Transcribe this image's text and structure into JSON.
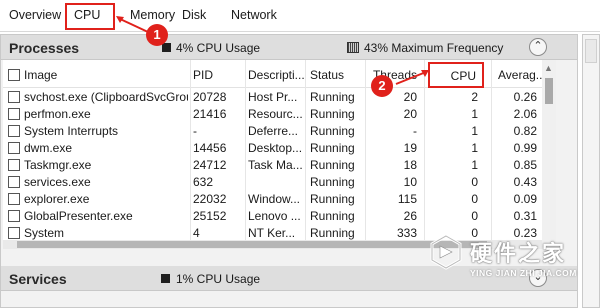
{
  "tabs": [
    "Overview",
    "CPU",
    "Memory",
    "Disk",
    "Network"
  ],
  "processes": {
    "title": "Processes",
    "cpu_usage": "4% CPU Usage",
    "max_frequency": "43% Maximum Frequency",
    "collapse_glyph": "⌃",
    "columns": [
      "Image",
      "PID",
      "Descripti...",
      "Status",
      "Threads",
      "CPU",
      "Averag..."
    ],
    "rows": [
      {
        "image": "svchost.exe (ClipboardSvcGrou...",
        "pid": "20728",
        "description": "Host Pr...",
        "status": "Running",
        "threads": "20",
        "cpu": "2",
        "avg": "0.26"
      },
      {
        "image": "perfmon.exe",
        "pid": "21416",
        "description": "Resourc...",
        "status": "Running",
        "threads": "20",
        "cpu": "1",
        "avg": "2.06"
      },
      {
        "image": "System Interrupts",
        "pid": "-",
        "description": "Deferre...",
        "status": "Running",
        "threads": "-",
        "cpu": "1",
        "avg": "0.82"
      },
      {
        "image": "dwm.exe",
        "pid": "14456",
        "description": "Desktop...",
        "status": "Running",
        "threads": "19",
        "cpu": "1",
        "avg": "0.99"
      },
      {
        "image": "Taskmgr.exe",
        "pid": "24712",
        "description": "Task Ma...",
        "status": "Running",
        "threads": "18",
        "cpu": "1",
        "avg": "0.85"
      },
      {
        "image": "services.exe",
        "pid": "632",
        "description": "",
        "status": "Running",
        "threads": "10",
        "cpu": "0",
        "avg": "0.43"
      },
      {
        "image": "explorer.exe",
        "pid": "22032",
        "description": "Window...",
        "status": "Running",
        "threads": "115",
        "cpu": "0",
        "avg": "0.09"
      },
      {
        "image": "GlobalPresenter.exe",
        "pid": "25152",
        "description": "Lenovo ...",
        "status": "Running",
        "threads": "26",
        "cpu": "0",
        "avg": "0.31"
      },
      {
        "image": "System",
        "pid": "4",
        "description": "NT Ker...",
        "status": "Running",
        "threads": "333",
        "cpu": "0",
        "avg": "0.23"
      }
    ]
  },
  "services": {
    "title": "Services",
    "cpu_usage": "1% CPU Usage",
    "collapse_glyph": "⌄"
  },
  "annotations": {
    "badge1": "1",
    "badge2": "2",
    "accent": "#e0211b"
  },
  "watermark": {
    "cn": "硬件之家",
    "en": "YING JIAN ZHI JIA.COM"
  }
}
